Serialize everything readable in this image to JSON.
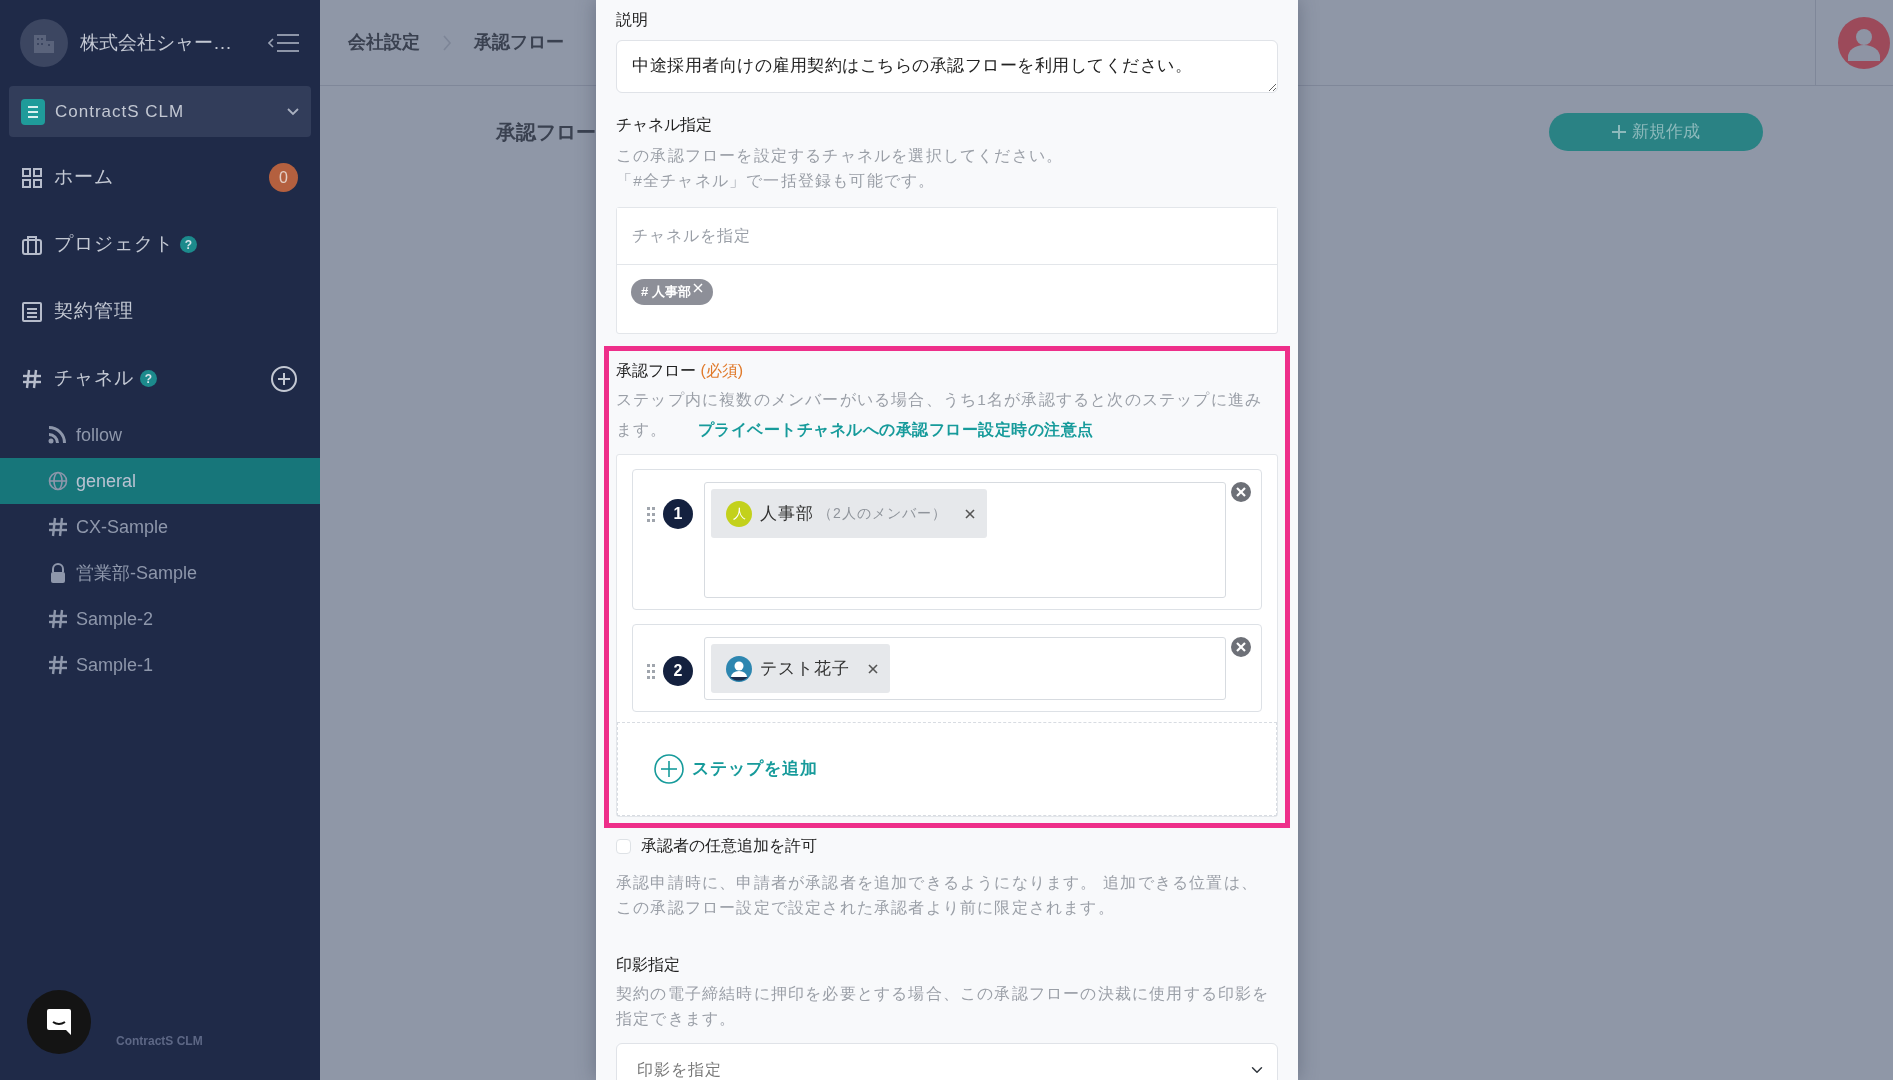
{
  "sidebar": {
    "company": "株式会社シャー…",
    "product": "ContractS CLM",
    "nav": [
      {
        "kind": "home",
        "label": "ホーム",
        "badge": "0"
      },
      {
        "kind": "project",
        "label": "プロジェクト",
        "help": "?"
      },
      {
        "kind": "contracts",
        "label": "契約管理"
      },
      {
        "kind": "channels",
        "label": "チャネル",
        "help": "?"
      }
    ],
    "channels": [
      {
        "kind": "feed",
        "name": "follow",
        "selected": false
      },
      {
        "kind": "public",
        "name": "general",
        "selected": true
      },
      {
        "kind": "hash",
        "name": "CX-Sample",
        "selected": false
      },
      {
        "kind": "private",
        "name": "営業部-Sample",
        "selected": false
      },
      {
        "kind": "hash",
        "name": "Sample-2",
        "selected": false
      },
      {
        "kind": "hash",
        "name": "Sample-1",
        "selected": false
      }
    ],
    "footer": "ContractS CLM"
  },
  "header": {
    "breadcrumb": [
      "会社設定",
      "承認フロー"
    ]
  },
  "page": {
    "title": "承認フロー",
    "new_button": "新規作成"
  },
  "modal": {
    "description": {
      "label": "説明",
      "value": "中途採用者向けの雇用契約はこちらの承認フローを利用してください。"
    },
    "channel": {
      "label": "チャネル指定",
      "help": [
        "この承認フローを設定するチャネルを選択してください。",
        "「#全チャネル」で一括登録も可能です。"
      ],
      "placeholder": "チャネルを指定",
      "tags": [
        "# 人事部"
      ]
    },
    "flow": {
      "label": "承認フロー",
      "required": "(必須)",
      "highlighted": true,
      "help": "ステップ内に複数のメンバーがいる場合、うち1名が承認すると次のステップに進みます。",
      "link": "プライベートチャネルへの承認フロー設定時の注意点",
      "steps": [
        {
          "number": "1",
          "members": [
            {
              "kind": "group",
              "avatar": "人",
              "name": "人事部",
              "note": "（2人のメンバー）"
            }
          ]
        },
        {
          "number": "2",
          "members": [
            {
              "kind": "user",
              "name": "テスト花子"
            }
          ]
        }
      ],
      "add_step": "ステップを追加"
    },
    "allow_add": {
      "label": "承認者の任意追加を許可",
      "checked": false,
      "help": "承認申請時に、申請者が承認者を追加できるようになります。 追加できる位置は、この承認フロー設定で設定された承認者より前に限定されます。"
    },
    "seal": {
      "label": "印影指定",
      "help": "契約の電子締結時に押印を必要とする場合、この承認フローの決裁に使用する印影を指定できます。",
      "placeholder": "印影を指定"
    }
  }
}
